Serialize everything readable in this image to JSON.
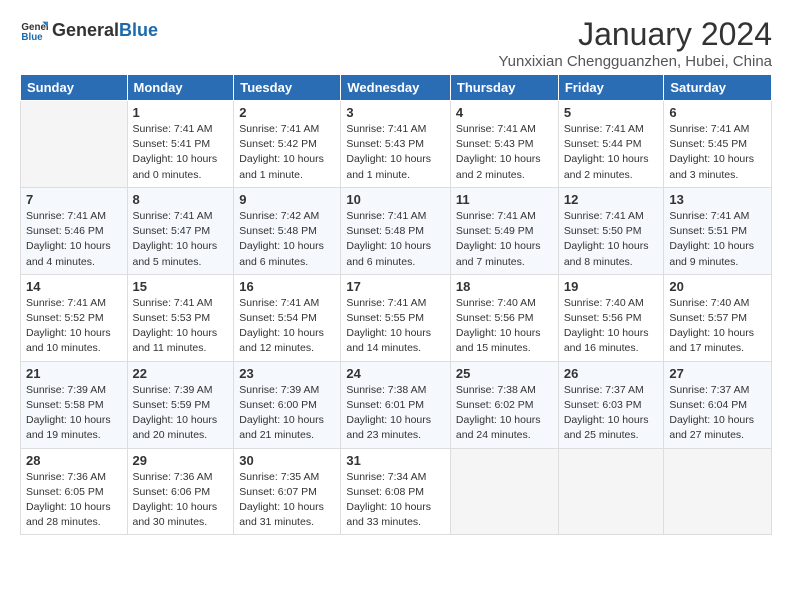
{
  "header": {
    "logo_general": "General",
    "logo_blue": "Blue",
    "title": "January 2024",
    "location": "Yunxixian Chengguanzhen, Hubei, China"
  },
  "calendar": {
    "days_of_week": [
      "Sunday",
      "Monday",
      "Tuesday",
      "Wednesday",
      "Thursday",
      "Friday",
      "Saturday"
    ],
    "weeks": [
      [
        {
          "day": "",
          "info": ""
        },
        {
          "day": "1",
          "info": "Sunrise: 7:41 AM\nSunset: 5:41 PM\nDaylight: 10 hours\nand 0 minutes."
        },
        {
          "day": "2",
          "info": "Sunrise: 7:41 AM\nSunset: 5:42 PM\nDaylight: 10 hours\nand 1 minute."
        },
        {
          "day": "3",
          "info": "Sunrise: 7:41 AM\nSunset: 5:43 PM\nDaylight: 10 hours\nand 1 minute."
        },
        {
          "day": "4",
          "info": "Sunrise: 7:41 AM\nSunset: 5:43 PM\nDaylight: 10 hours\nand 2 minutes."
        },
        {
          "day": "5",
          "info": "Sunrise: 7:41 AM\nSunset: 5:44 PM\nDaylight: 10 hours\nand 2 minutes."
        },
        {
          "day": "6",
          "info": "Sunrise: 7:41 AM\nSunset: 5:45 PM\nDaylight: 10 hours\nand 3 minutes."
        }
      ],
      [
        {
          "day": "7",
          "info": "Sunrise: 7:41 AM\nSunset: 5:46 PM\nDaylight: 10 hours\nand 4 minutes."
        },
        {
          "day": "8",
          "info": "Sunrise: 7:41 AM\nSunset: 5:47 PM\nDaylight: 10 hours\nand 5 minutes."
        },
        {
          "day": "9",
          "info": "Sunrise: 7:42 AM\nSunset: 5:48 PM\nDaylight: 10 hours\nand 6 minutes."
        },
        {
          "day": "10",
          "info": "Sunrise: 7:41 AM\nSunset: 5:48 PM\nDaylight: 10 hours\nand 6 minutes."
        },
        {
          "day": "11",
          "info": "Sunrise: 7:41 AM\nSunset: 5:49 PM\nDaylight: 10 hours\nand 7 minutes."
        },
        {
          "day": "12",
          "info": "Sunrise: 7:41 AM\nSunset: 5:50 PM\nDaylight: 10 hours\nand 8 minutes."
        },
        {
          "day": "13",
          "info": "Sunrise: 7:41 AM\nSunset: 5:51 PM\nDaylight: 10 hours\nand 9 minutes."
        }
      ],
      [
        {
          "day": "14",
          "info": "Sunrise: 7:41 AM\nSunset: 5:52 PM\nDaylight: 10 hours\nand 10 minutes."
        },
        {
          "day": "15",
          "info": "Sunrise: 7:41 AM\nSunset: 5:53 PM\nDaylight: 10 hours\nand 11 minutes."
        },
        {
          "day": "16",
          "info": "Sunrise: 7:41 AM\nSunset: 5:54 PM\nDaylight: 10 hours\nand 12 minutes."
        },
        {
          "day": "17",
          "info": "Sunrise: 7:41 AM\nSunset: 5:55 PM\nDaylight: 10 hours\nand 14 minutes."
        },
        {
          "day": "18",
          "info": "Sunrise: 7:40 AM\nSunset: 5:56 PM\nDaylight: 10 hours\nand 15 minutes."
        },
        {
          "day": "19",
          "info": "Sunrise: 7:40 AM\nSunset: 5:56 PM\nDaylight: 10 hours\nand 16 minutes."
        },
        {
          "day": "20",
          "info": "Sunrise: 7:40 AM\nSunset: 5:57 PM\nDaylight: 10 hours\nand 17 minutes."
        }
      ],
      [
        {
          "day": "21",
          "info": "Sunrise: 7:39 AM\nSunset: 5:58 PM\nDaylight: 10 hours\nand 19 minutes."
        },
        {
          "day": "22",
          "info": "Sunrise: 7:39 AM\nSunset: 5:59 PM\nDaylight: 10 hours\nand 20 minutes."
        },
        {
          "day": "23",
          "info": "Sunrise: 7:39 AM\nSunset: 6:00 PM\nDaylight: 10 hours\nand 21 minutes."
        },
        {
          "day": "24",
          "info": "Sunrise: 7:38 AM\nSunset: 6:01 PM\nDaylight: 10 hours\nand 23 minutes."
        },
        {
          "day": "25",
          "info": "Sunrise: 7:38 AM\nSunset: 6:02 PM\nDaylight: 10 hours\nand 24 minutes."
        },
        {
          "day": "26",
          "info": "Sunrise: 7:37 AM\nSunset: 6:03 PM\nDaylight: 10 hours\nand 25 minutes."
        },
        {
          "day": "27",
          "info": "Sunrise: 7:37 AM\nSunset: 6:04 PM\nDaylight: 10 hours\nand 27 minutes."
        }
      ],
      [
        {
          "day": "28",
          "info": "Sunrise: 7:36 AM\nSunset: 6:05 PM\nDaylight: 10 hours\nand 28 minutes."
        },
        {
          "day": "29",
          "info": "Sunrise: 7:36 AM\nSunset: 6:06 PM\nDaylight: 10 hours\nand 30 minutes."
        },
        {
          "day": "30",
          "info": "Sunrise: 7:35 AM\nSunset: 6:07 PM\nDaylight: 10 hours\nand 31 minutes."
        },
        {
          "day": "31",
          "info": "Sunrise: 7:34 AM\nSunset: 6:08 PM\nDaylight: 10 hours\nand 33 minutes."
        },
        {
          "day": "",
          "info": ""
        },
        {
          "day": "",
          "info": ""
        },
        {
          "day": "",
          "info": ""
        }
      ]
    ]
  }
}
